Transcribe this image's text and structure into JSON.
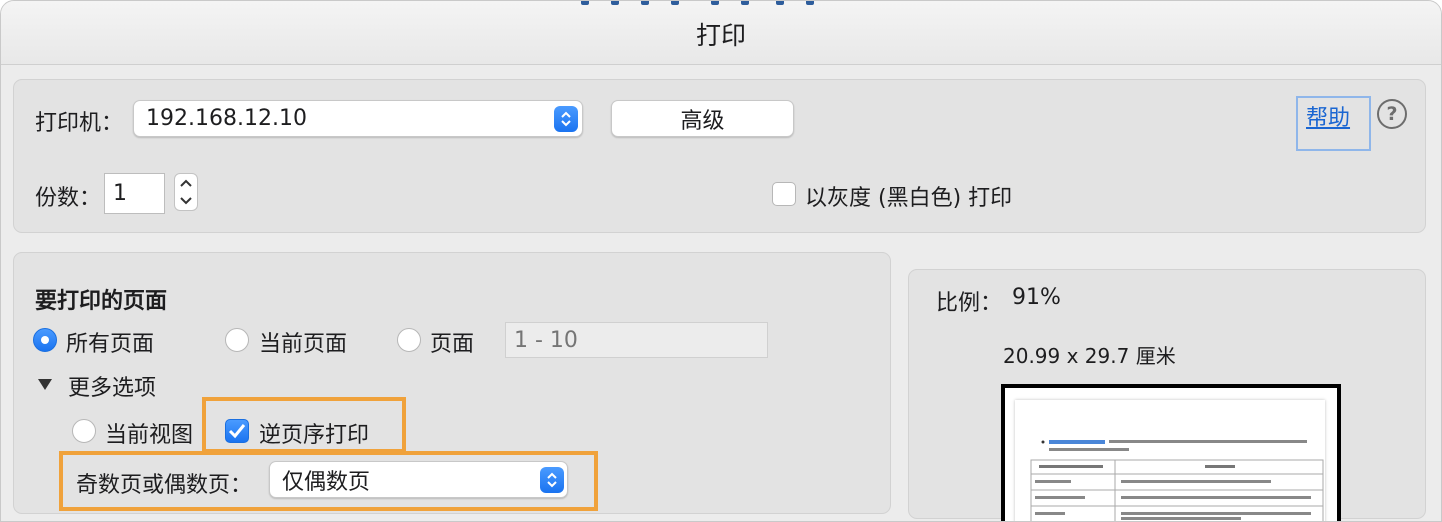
{
  "dialog": {
    "title": "打印"
  },
  "printer": {
    "label": "打印机：",
    "value": "192.168.12.10",
    "advanced_label": "高级",
    "help_label": "帮助",
    "help_icon": "question-circle-icon"
  },
  "copies": {
    "label": "份数：",
    "value": "1"
  },
  "grayscale": {
    "label": "以灰度 (黑白色) 打印",
    "checked": false
  },
  "pages": {
    "heading": "要打印的页面",
    "options": [
      {
        "label": "所有页面",
        "selected": true
      },
      {
        "label": "当前页面",
        "selected": false
      },
      {
        "label": "页面",
        "selected": false
      }
    ],
    "range_placeholder": "1 - 10",
    "more_options_label": "更多选项",
    "current_view_label": "当前视图",
    "reverse_label": "逆页序打印",
    "reverse_checked": true,
    "odd_even_label": "奇数页或偶数页：",
    "odd_even_value": "仅偶数页"
  },
  "preview": {
    "scale_label": "比例：",
    "scale_value": "91%",
    "paper_size": "20.99 x 29.7 厘米"
  },
  "colors": {
    "accent": "#1a73f0",
    "highlight": "#f0a23b",
    "link": "#1a66d2"
  }
}
